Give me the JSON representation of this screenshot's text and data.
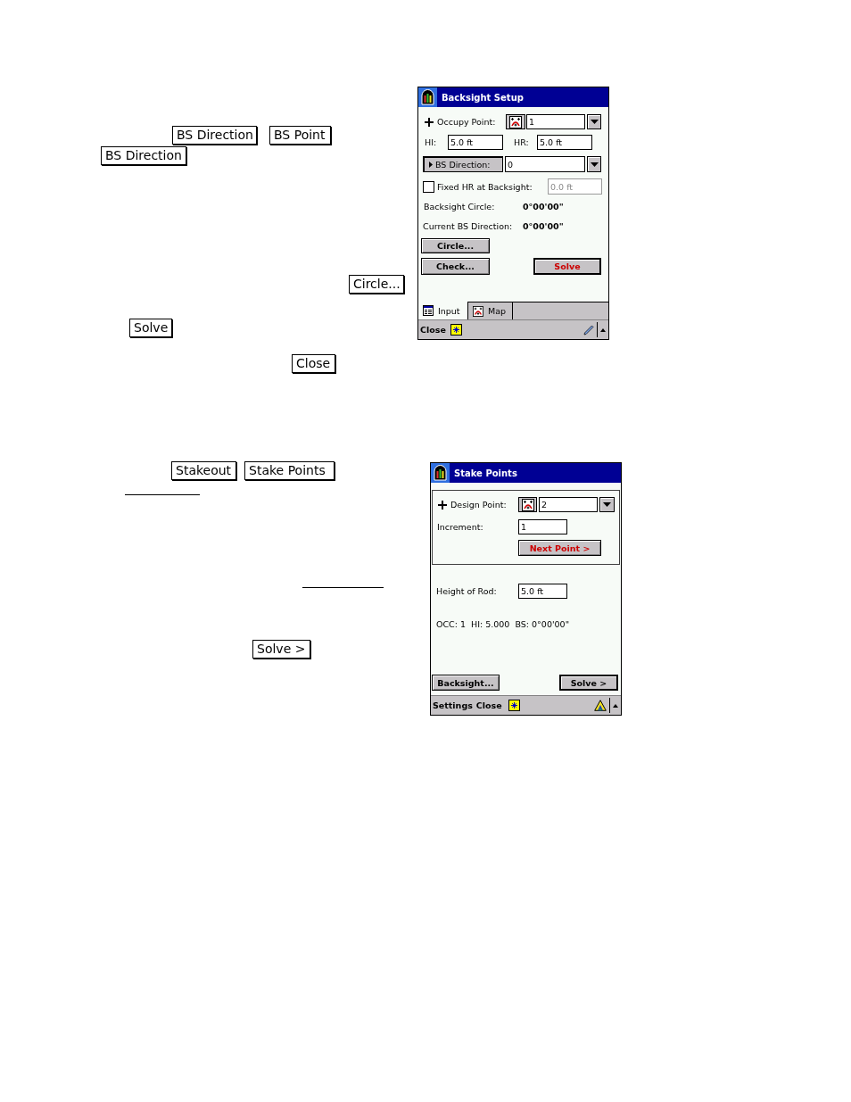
{
  "backsight_section": {
    "callout_lines": [
      [
        {
          "kind": "key",
          "text": "BS Direction"
        },
        {
          "kind": "key",
          "text": "BS Point"
        }
      ],
      [
        {
          "kind": "key",
          "text": "BS Direction"
        }
      ],
      [
        {
          "kind": "key",
          "text": "Circle..."
        }
      ],
      [
        {
          "kind": "key",
          "text": "Solve"
        }
      ],
      [
        {
          "kind": "key",
          "text": "Close"
        }
      ]
    ],
    "window": {
      "title": "Backsight Setup",
      "occupy_point": {
        "label": "Occupy Point:",
        "value": "1"
      },
      "hi": {
        "label": "HI:",
        "value": "5.0 ft"
      },
      "hr": {
        "label": "HR:",
        "value": "5.0 ft"
      },
      "bs_direction": {
        "button": "BS Direction:",
        "value": "0"
      },
      "fixed_hr": {
        "label": "Fixed HR at Backsight:",
        "checked": false,
        "value": "0.0 ft",
        "disabled": true
      },
      "readouts": [
        {
          "label": "Backsight Circle:",
          "value": "0°00'00\""
        },
        {
          "label": "Current BS Direction:",
          "value": "0°00'00\""
        }
      ],
      "buttons": [
        {
          "label": "Circle...",
          "default": false,
          "highlighted": false
        },
        {
          "label": "Check...",
          "default": false,
          "highlighted": false
        },
        {
          "label": "Solve",
          "default": true,
          "highlighted": true
        }
      ],
      "tabs": [
        {
          "label": "Input",
          "selected": true
        },
        {
          "label": "Map",
          "selected": false
        }
      ],
      "menu": [
        "Close"
      ]
    }
  },
  "stakeout_section": {
    "callout_lines": [
      [
        {
          "kind": "key",
          "text": "Stakeout"
        },
        {
          "kind": "key",
          "text": "Stake Points"
        }
      ],
      [
        {
          "kind": "blank"
        }
      ],
      [
        {
          "kind": "blank"
        }
      ],
      [
        {
          "kind": "key",
          "text": "Solve >"
        }
      ]
    ],
    "window": {
      "title": "Stake Points",
      "design_point": {
        "label": "Design Point:",
        "value": "2"
      },
      "increment": {
        "label": "Increment:",
        "value": "1"
      },
      "height_of_rod": {
        "label": "Height of Rod:",
        "value": "5.0 ft"
      },
      "status_line": "OCC: 1  HI: 5.000  BS: 0°00'00\"",
      "buttons": [
        {
          "label": "Next Point >",
          "default": false,
          "highlighted": true
        },
        {
          "label": "Backsight...",
          "default": false,
          "highlighted": false
        },
        {
          "label": "Solve >",
          "default": true,
          "highlighted": false
        }
      ],
      "menu": [
        "Settings",
        "Close"
      ]
    }
  }
}
